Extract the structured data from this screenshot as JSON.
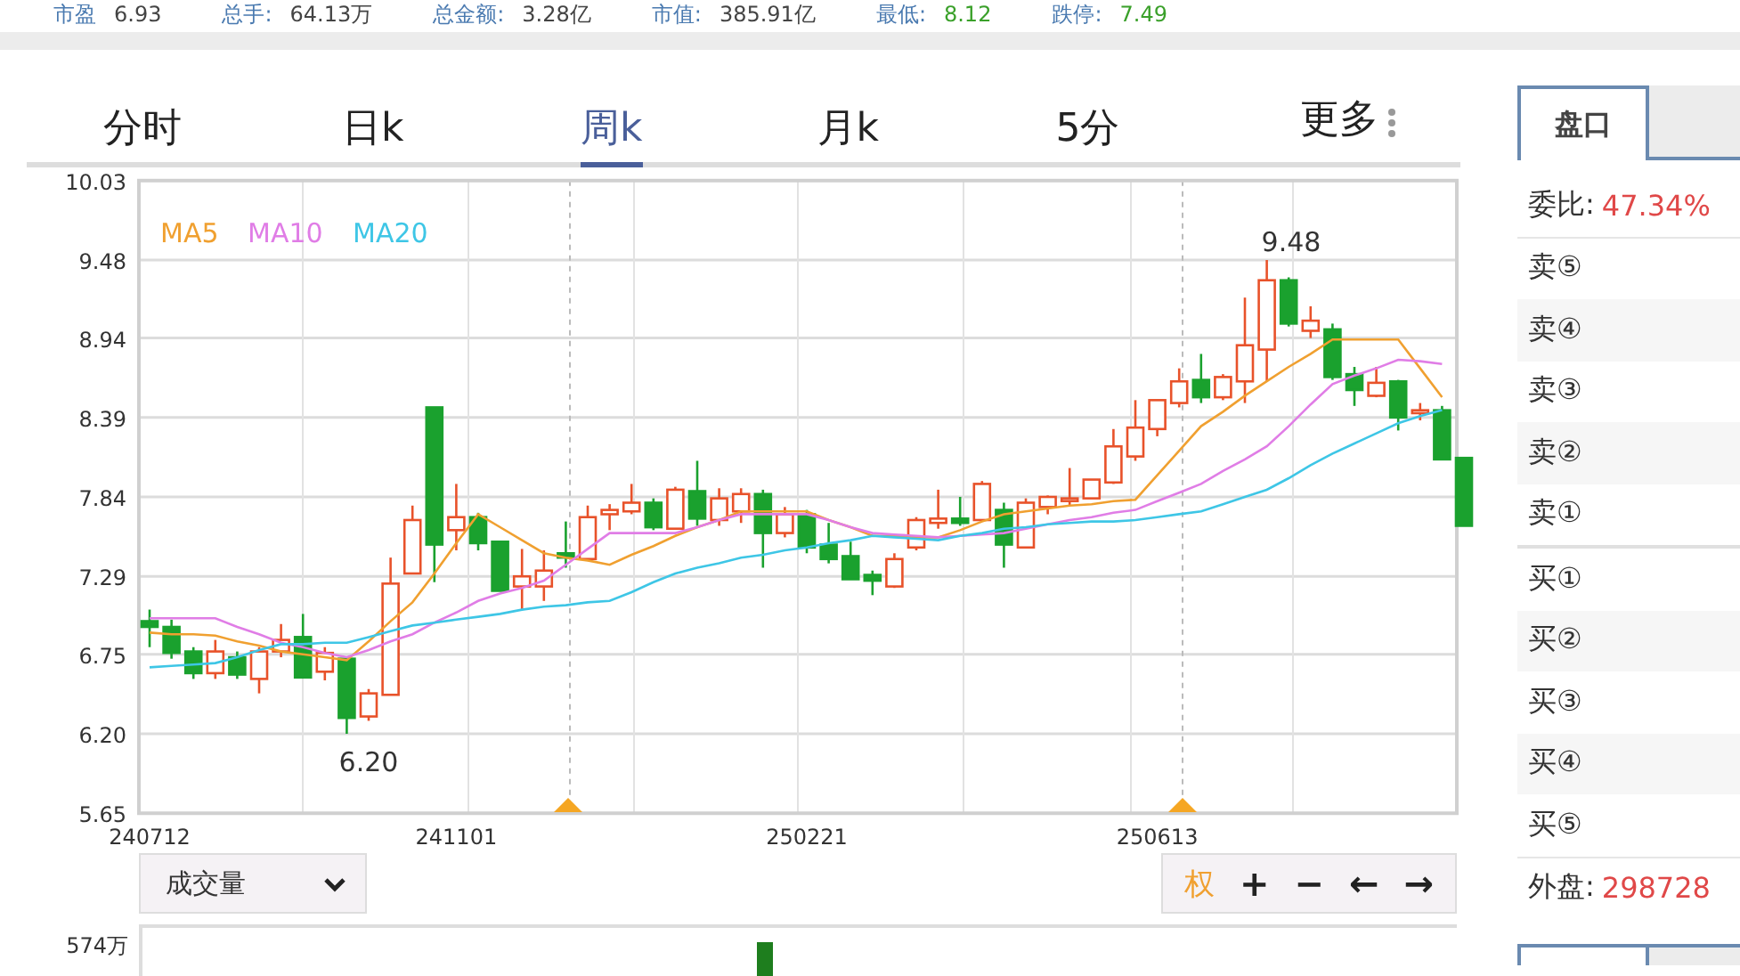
{
  "quote_bar": [
    {
      "label": "市盈",
      "value": "6.93"
    },
    {
      "label": "总手:",
      "value": "64.13万"
    },
    {
      "label": "总金额:",
      "value": "3.28亿"
    },
    {
      "label": "市值:",
      "value": "385.91亿"
    },
    {
      "label": "最低:",
      "value": "8.12"
    },
    {
      "label": "跌停:",
      "value": "7.49"
    }
  ],
  "period_tabs": [
    {
      "label": "分时",
      "selected": false
    },
    {
      "label": "日k",
      "selected": false
    },
    {
      "label": "周k",
      "selected": true
    },
    {
      "label": "月k",
      "selected": false
    },
    {
      "label": "5分",
      "selected": false
    },
    {
      "label": "更多",
      "selected": false
    }
  ],
  "chart": {
    "chart_data": {
      "type": "candlestick",
      "categories": [
        "240712",
        null,
        null,
        null,
        null,
        null,
        null,
        null,
        null,
        null,
        null,
        null,
        null,
        null,
        "241101",
        null,
        null,
        null,
        null,
        null,
        null,
        null,
        null,
        null,
        null,
        null,
        null,
        null,
        null,
        null,
        "250221",
        null,
        null,
        null,
        null,
        null,
        null,
        null,
        null,
        null,
        null,
        null,
        null,
        null,
        null,
        null,
        "250613",
        null,
        null,
        null,
        null,
        null,
        null,
        null,
        null,
        null,
        null,
        null,
        null,
        null,
        null
      ],
      "ohlc": [
        [
          6.98,
          7.06,
          6.8,
          6.94
        ],
        [
          6.94,
          6.99,
          6.72,
          6.76
        ],
        [
          6.77,
          6.8,
          6.58,
          6.62
        ],
        [
          6.62,
          6.85,
          6.58,
          6.77
        ],
        [
          6.73,
          6.77,
          6.58,
          6.61
        ],
        [
          6.58,
          6.8,
          6.48,
          6.77
        ],
        [
          6.77,
          6.96,
          6.73,
          6.85
        ],
        [
          6.87,
          7.03,
          6.59,
          6.59
        ],
        [
          6.63,
          6.8,
          6.57,
          6.76
        ],
        [
          6.72,
          6.73,
          6.2,
          6.31
        ],
        [
          6.32,
          6.51,
          6.29,
          6.48
        ],
        [
          6.47,
          7.42,
          6.47,
          7.24
        ],
        [
          7.31,
          7.78,
          7.31,
          7.68
        ],
        [
          8.46,
          8.46,
          7.25,
          7.51
        ],
        [
          7.61,
          7.93,
          7.47,
          7.7
        ],
        [
          7.7,
          7.73,
          7.47,
          7.52
        ],
        [
          7.53,
          7.53,
          7.19,
          7.19
        ],
        [
          7.22,
          7.48,
          7.06,
          7.29
        ],
        [
          7.22,
          7.47,
          7.12,
          7.33
        ],
        [
          7.45,
          7.67,
          7.35,
          7.42
        ],
        [
          7.41,
          7.78,
          7.41,
          7.7
        ],
        [
          7.72,
          7.79,
          7.61,
          7.75
        ],
        [
          7.74,
          7.93,
          7.72,
          7.8
        ],
        [
          7.8,
          7.83,
          7.61,
          7.63
        ],
        [
          7.62,
          7.91,
          7.62,
          7.89
        ],
        [
          7.88,
          8.09,
          7.64,
          7.69
        ],
        [
          7.68,
          7.9,
          7.64,
          7.83
        ],
        [
          7.74,
          7.9,
          7.66,
          7.86
        ],
        [
          7.86,
          7.89,
          7.35,
          7.59
        ],
        [
          7.59,
          7.77,
          7.56,
          7.72
        ],
        [
          7.72,
          7.75,
          7.45,
          7.49
        ],
        [
          7.51,
          7.66,
          7.38,
          7.41
        ],
        [
          7.43,
          7.53,
          7.27,
          7.27
        ],
        [
          7.3,
          7.33,
          7.16,
          7.26
        ],
        [
          7.22,
          7.45,
          7.21,
          7.41
        ],
        [
          7.49,
          7.7,
          7.47,
          7.68
        ],
        [
          7.66,
          7.89,
          7.62,
          7.69
        ],
        [
          7.69,
          7.84,
          7.64,
          7.66
        ],
        [
          7.68,
          7.95,
          7.68,
          7.93
        ],
        [
          7.75,
          7.8,
          7.35,
          7.51
        ],
        [
          7.49,
          7.83,
          7.49,
          7.8
        ],
        [
          7.77,
          7.85,
          7.72,
          7.84
        ],
        [
          7.82,
          8.04,
          7.78,
          7.83
        ],
        [
          7.83,
          7.96,
          7.83,
          7.96
        ],
        [
          7.94,
          8.31,
          7.93,
          8.19
        ],
        [
          8.12,
          8.51,
          8.09,
          8.32
        ],
        [
          8.31,
          8.51,
          8.26,
          8.51
        ],
        [
          8.49,
          8.73,
          8.46,
          8.64
        ],
        [
          8.65,
          8.83,
          8.49,
          8.53
        ],
        [
          8.53,
          8.69,
          8.51,
          8.67
        ],
        [
          8.64,
          9.22,
          8.49,
          8.89
        ],
        [
          8.86,
          9.48,
          8.64,
          9.34
        ],
        [
          9.34,
          9.36,
          9.02,
          9.04
        ],
        [
          8.99,
          9.16,
          8.94,
          9.06
        ],
        [
          9.0,
          9.04,
          8.65,
          8.67
        ],
        [
          8.69,
          8.74,
          8.47,
          8.58
        ],
        [
          8.54,
          8.74,
          8.53,
          8.63
        ],
        [
          8.64,
          8.65,
          8.3,
          8.39
        ],
        [
          8.42,
          8.49,
          8.37,
          8.44
        ],
        [
          8.44,
          8.47,
          8.1,
          8.1
        ],
        [
          8.11,
          8.11,
          7.64,
          7.64
        ]
      ],
      "grid": true,
      "ylim": [
        5.65,
        10.03
      ],
      "yticks": [
        {
          "value": 10.03,
          "label": "10.03"
        },
        {
          "value": 9.48,
          "label": "9.48"
        },
        {
          "value": 8.94,
          "label": "8.94"
        },
        {
          "value": 8.39,
          "label": "8.39"
        },
        {
          "value": 7.84,
          "label": "7.84"
        },
        {
          "value": 7.29,
          "label": "7.29"
        },
        {
          "value": 6.75,
          "label": "6.75"
        },
        {
          "value": 6.2,
          "label": "6.20"
        },
        {
          "value": 5.65,
          "label": "5.65"
        }
      ]
    },
    "moving_averages": {
      "chart_data": {
        "type": "line",
        "series": [
          {
            "name": "MA5",
            "color": "#f0a030",
            "values": [
              6.9,
              6.89,
              6.89,
              6.88,
              6.84,
              6.81,
              6.77,
              6.75,
              6.73,
              6.71,
              6.84,
              6.98,
              7.11,
              7.31,
              7.52,
              7.72,
              7.63,
              7.54,
              7.45,
              7.42,
              7.4,
              7.37,
              7.44,
              7.5,
              7.57,
              7.63,
              7.68,
              7.74,
              7.74,
              7.74,
              7.74,
              7.68,
              7.63,
              7.57,
              7.57,
              7.56,
              7.56,
              7.61,
              7.67,
              7.72,
              7.74,
              7.76,
              7.78,
              7.79,
              7.81,
              7.82,
              7.99,
              8.16,
              8.33,
              8.43,
              8.54,
              8.64,
              8.74,
              8.83,
              8.93,
              8.93,
              8.93,
              8.93,
              8.73,
              8.53,
              null
            ]
          },
          {
            "name": "MA10",
            "color": "#e07de6",
            "values": [
              7.0,
              7.0,
              7.0,
              7.0,
              6.94,
              6.89,
              6.83,
              6.8,
              6.76,
              6.73,
              6.78,
              6.84,
              6.89,
              6.97,
              7.04,
              7.12,
              7.17,
              7.21,
              7.26,
              7.37,
              7.48,
              7.59,
              7.59,
              7.59,
              7.59,
              7.63,
              7.68,
              7.72,
              7.72,
              7.72,
              7.72,
              7.68,
              7.63,
              7.59,
              7.58,
              7.57,
              7.56,
              7.57,
              7.58,
              7.59,
              7.62,
              7.65,
              7.68,
              7.7,
              7.73,
              7.75,
              7.81,
              7.87,
              7.93,
              8.02,
              8.1,
              8.19,
              8.33,
              8.48,
              8.62,
              8.68,
              8.73,
              8.79,
              8.78,
              8.76,
              null
            ]
          },
          {
            "name": "MA20",
            "color": "#3ec6e6",
            "values": [
              6.66,
              6.67,
              6.68,
              6.69,
              6.73,
              6.78,
              6.82,
              6.82,
              6.83,
              6.83,
              6.87,
              6.91,
              6.95,
              6.97,
              6.99,
              7.01,
              7.03,
              7.06,
              7.08,
              7.09,
              7.11,
              7.12,
              7.18,
              7.25,
              7.31,
              7.35,
              7.38,
              7.42,
              7.44,
              7.47,
              7.49,
              7.52,
              7.54,
              7.57,
              7.56,
              7.55,
              7.54,
              7.57,
              7.59,
              7.62,
              7.63,
              7.65,
              7.66,
              7.67,
              7.67,
              7.68,
              7.7,
              7.72,
              7.74,
              7.79,
              7.84,
              7.89,
              7.97,
              8.06,
              8.14,
              8.21,
              8.28,
              8.35,
              8.4,
              8.44,
              null
            ]
          }
        ],
        "ylim": [
          5.65,
          10.03
        ]
      }
    },
    "high_label": "9.48",
    "low_label": "6.20"
  },
  "indicator_select": {
    "value": "成交量"
  },
  "chart_tools": [
    {
      "label": "权",
      "kind": "text"
    },
    {
      "label": "+",
      "kind": "symbol"
    },
    {
      "label": "−",
      "kind": "symbol"
    },
    {
      "label": "←",
      "kind": "symbol"
    },
    {
      "label": "→",
      "kind": "symbol"
    }
  ],
  "volume_axis_label": "574万",
  "side_tabs": [
    {
      "label": "盘口",
      "selected": true
    }
  ],
  "order_book": {
    "summary": {
      "label": "委比:",
      "value": "47.34%"
    },
    "asks": [
      "卖⑤",
      "卖④",
      "卖③",
      "卖②",
      "卖①"
    ],
    "bids": [
      "买①",
      "买②",
      "买③",
      "买④",
      "买⑤"
    ],
    "footer": {
      "label": "外盘:",
      "value": "298728"
    }
  }
}
